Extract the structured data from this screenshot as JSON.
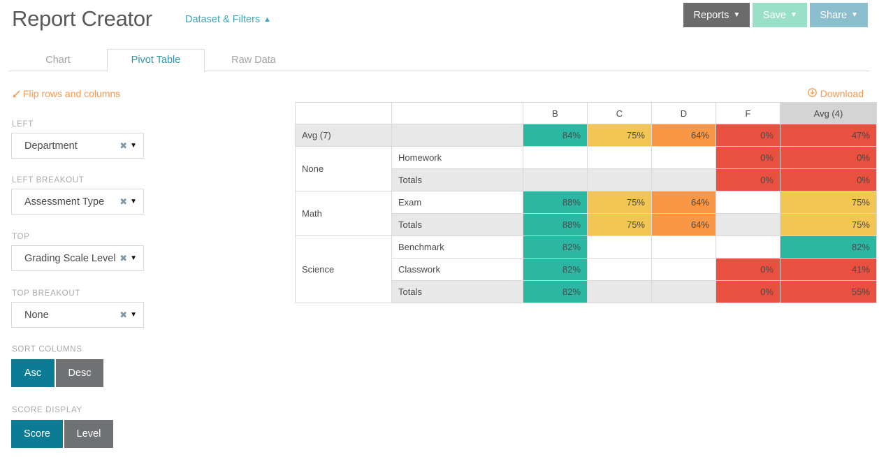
{
  "header": {
    "title": "Report Creator",
    "dataset_link": "Dataset & Filters",
    "dataset_caret_icon": "chevron-up-icon",
    "buttons": [
      {
        "label": "Reports",
        "color": "#6b6b6b",
        "caret_icon": "chevron-down-icon"
      },
      {
        "label": "Save",
        "color": "#9adfc8",
        "caret_icon": "chevron-down-icon"
      },
      {
        "label": "Share",
        "color": "#8cbfcd",
        "caret_icon": "chevron-down-icon"
      }
    ]
  },
  "tabs": {
    "items": [
      {
        "label": "Chart",
        "active": false
      },
      {
        "label": "Pivot Table",
        "active": true
      },
      {
        "label": "Raw Data",
        "active": false
      }
    ]
  },
  "sidebar": {
    "flip_link": "Flip rows and columns",
    "flip_icon": "diagonal-arrow-icon",
    "fields": [
      {
        "label": "LEFT",
        "value": "Department",
        "clear_icon": "clear-x-icon",
        "caret_icon": "caret-down-icon"
      },
      {
        "label": "LEFT BREAKOUT",
        "value": "Assessment Type",
        "clear_icon": "clear-x-icon",
        "caret_icon": "caret-down-icon"
      },
      {
        "label": "TOP",
        "value": "Grading Scale Level",
        "clear_icon": "clear-x-icon",
        "caret_icon": "caret-down-icon"
      },
      {
        "label": "TOP BREAKOUT",
        "value": "None",
        "clear_icon": "clear-x-icon",
        "caret_icon": "caret-down-icon"
      }
    ],
    "sort_columns": {
      "label": "SORT COLUMNS",
      "options": [
        {
          "label": "Asc",
          "active": true
        },
        {
          "label": "Desc",
          "active": false
        }
      ]
    },
    "score_display": {
      "label": "SCORE DISPLAY",
      "options": [
        {
          "label": "Score",
          "active": true
        },
        {
          "label": "Level",
          "active": false
        }
      ]
    }
  },
  "main": {
    "download_label": "Download",
    "download_icon": "download-circle-icon"
  },
  "chart_data": {
    "type": "table",
    "title": "Pivot Table",
    "row_header_1": "",
    "row_header_2": "",
    "columns": [
      "B",
      "C",
      "D",
      "F",
      "Avg (4)"
    ],
    "rows": [
      {
        "group": "Avg (7)",
        "sub": "",
        "kind": "aggregate",
        "values": [
          "84%",
          "75%",
          "64%",
          "0%",
          "47%"
        ],
        "colors": [
          "#2bb8a3",
          "#f2c554",
          "#f99746",
          "#e8503f",
          "#e8503f"
        ]
      },
      {
        "group": "None",
        "sub": "Homework",
        "kind": "detail",
        "values": [
          "",
          "",
          "",
          "0%",
          "0%"
        ],
        "colors": [
          "",
          "",
          "",
          "#e8503f",
          "#e8503f"
        ]
      },
      {
        "group": "None",
        "sub": "Totals",
        "kind": "totals",
        "values": [
          "",
          "",
          "",
          "0%",
          "0%"
        ],
        "colors": [
          "",
          "",
          "",
          "#e8503f",
          "#e8503f"
        ]
      },
      {
        "group": "Math",
        "sub": "Exam",
        "kind": "detail",
        "values": [
          "88%",
          "75%",
          "64%",
          "",
          "75%"
        ],
        "colors": [
          "#2bb8a3",
          "#f2c554",
          "#f99746",
          "",
          "#f2c554"
        ]
      },
      {
        "group": "Math",
        "sub": "Totals",
        "kind": "totals",
        "values": [
          "88%",
          "75%",
          "64%",
          "",
          "75%"
        ],
        "colors": [
          "#2bb8a3",
          "#f2c554",
          "#f99746",
          "",
          "#f2c554"
        ]
      },
      {
        "group": "Science",
        "sub": "Benchmark",
        "kind": "detail",
        "values": [
          "82%",
          "",
          "",
          "",
          "82%"
        ],
        "colors": [
          "#2bb8a3",
          "",
          "",
          "",
          "#2bb8a3"
        ]
      },
      {
        "group": "Science",
        "sub": "Classwork",
        "kind": "detail",
        "values": [
          "82%",
          "",
          "",
          "0%",
          "41%"
        ],
        "colors": [
          "#2bb8a3",
          "",
          "",
          "#e8503f",
          "#e8503f"
        ]
      },
      {
        "group": "Science",
        "sub": "Totals",
        "kind": "totals",
        "values": [
          "82%",
          "",
          "",
          "0%",
          "55%"
        ],
        "colors": [
          "#2bb8a3",
          "",
          "",
          "#e8503f",
          "#e8503f"
        ]
      }
    ],
    "group_spans": [
      {
        "label": "Avg (7)",
        "span": 1
      },
      {
        "label": "None",
        "span": 2
      },
      {
        "label": "Math",
        "span": 2
      },
      {
        "label": "Science",
        "span": 3
      }
    ],
    "legend_colors": {
      "high": "#2bb8a3",
      "mid": "#f2c554",
      "low": "#f99746",
      "fail": "#e8503f",
      "totals_bg": "#e8e8e8",
      "avg_head_bg": "#d4d4d4"
    }
  }
}
